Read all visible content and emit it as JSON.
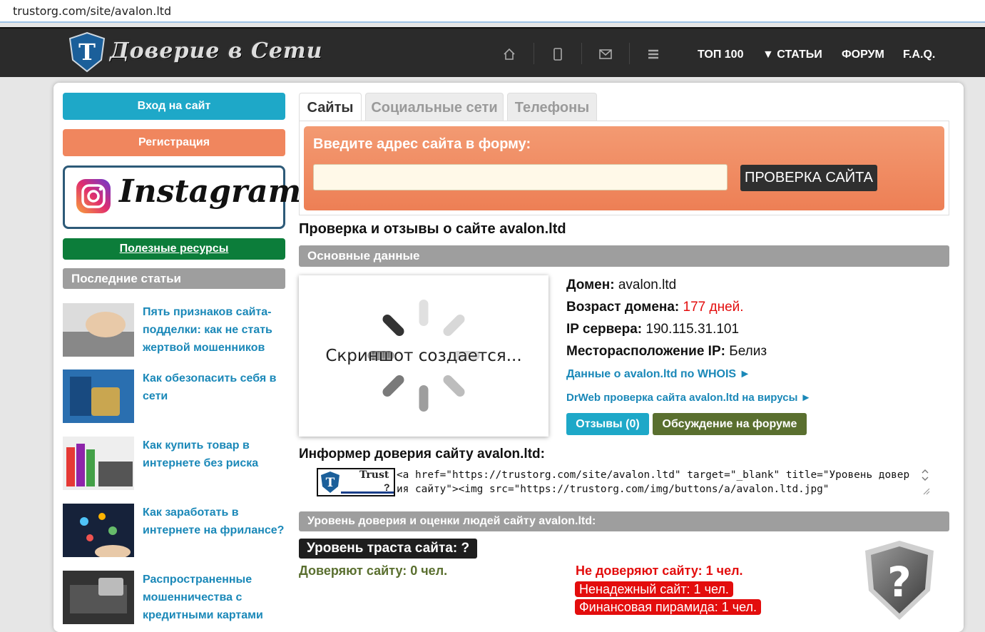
{
  "browser": {
    "url": "trustorg.com/site/avalon.ltd"
  },
  "header": {
    "logo_text": "Доверие в Сети",
    "nav": [
      "ТОП 100",
      "▼ СТАТЬИ",
      "ФОРУМ",
      "F.A.Q."
    ]
  },
  "sidebar": {
    "login": "Вход на сайт",
    "register": "Регистрация",
    "instagram": "Instagram",
    "resources": "Полезные ресурсы",
    "recent_title": "Последние статьи",
    "articles": [
      {
        "title": "Пять признаков сайта-подделки: как не стать жертвой мошенников"
      },
      {
        "title": "Как обезопасить себя в сети"
      },
      {
        "title": "Как купить товар в интернете без риска"
      },
      {
        "title": "Как заработать в интернете на фрилансе?"
      },
      {
        "title": "Распространенные мошенничества с кредитными картами"
      }
    ]
  },
  "tabs": [
    "Сайты",
    "Социальные сети",
    "Телефоны"
  ],
  "form": {
    "label": "Введите адрес сайта в форму:",
    "button": "ПРОВЕРКА САЙТА",
    "value": ""
  },
  "main": {
    "page_title": "Проверка и отзывы о сайте avalon.ltd",
    "basic_section": "Основные данные",
    "screenshot_text": "Скриншот создается...",
    "domain_label": "Домен:",
    "domain_value": "avalon.ltd",
    "age_label": "Возраст домена:",
    "age_value": "177 дней.",
    "ip_label": "IP сервера:",
    "ip_value": "190.115.31.101",
    "loc_label": "Месторасположение IP:",
    "loc_value": "Белиз",
    "whois_link": "Данные о avalon.ltd по WHOIS ►",
    "drweb_link": "DrWeb проверка сайта avalon.ltd на вирусы ►",
    "reviews_btn": "Отзывы (0)",
    "forum_btn": "Обсуждение на форуме",
    "informer_title": "Информер доверия сайту avalon.ltd:",
    "informer_badge_text": "Trust",
    "informer_badge_q": "?",
    "informer_code": "<a href=\"https://trustorg.com/site/avalon.ltd\" target=\"_blank\" title=\"Уровень доверия сайту\"><img src=\"https://trustorg.com/img/buttons/a/avalon.ltd.jpg\"",
    "trust_section": "Уровень доверия и оценки людей сайту avalon.ltd:",
    "trust_level": "Уровень траста сайта: ?",
    "trust_yes": "Доверяют сайту: 0 чел.",
    "trust_no": "Не доверяют сайту: 1 чел.",
    "unreliable": "Ненадежный сайт: 1 чел.",
    "pyramid": "Финансовая пирамида: 1 чел.",
    "shield_q": "?"
  },
  "colors": {
    "accent_blue": "#1ea8c8",
    "orange": "#f0865e",
    "green": "#0c7d3a",
    "red": "#e30d0d",
    "olive": "#5a6f2f"
  }
}
